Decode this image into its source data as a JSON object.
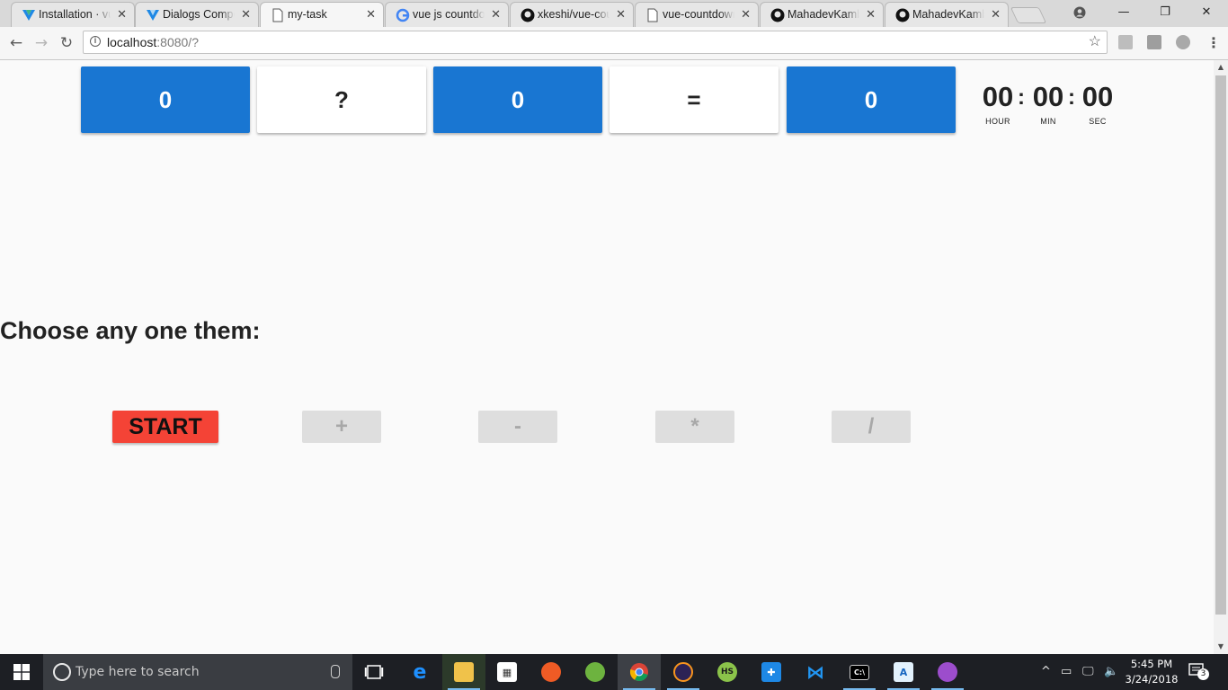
{
  "browser": {
    "tabs": [
      {
        "title": "Installation · vuetify",
        "icon": "vuetify-logo-icon"
      },
      {
        "title": "Dialogs Component",
        "icon": "vuetify-logo-icon"
      },
      {
        "title": "my-task",
        "icon": "page-icon",
        "active": true
      },
      {
        "title": "vue js countdown",
        "icon": "google-icon"
      },
      {
        "title": "xkeshi/vue-countdown",
        "icon": "github-icon"
      },
      {
        "title": "vue-countdown",
        "icon": "page-icon"
      },
      {
        "title": "MahadevKamble",
        "icon": "github-icon"
      },
      {
        "title": "MahadevKamble",
        "icon": "github-icon"
      }
    ],
    "address": {
      "host": "localhost",
      "rest": ":8080/?"
    }
  },
  "page": {
    "cards": [
      {
        "value": "0",
        "color": "#1976d2"
      },
      {
        "value": "?",
        "color": "#ffffff"
      },
      {
        "value": "0",
        "color": "#1976d2"
      },
      {
        "value": "=",
        "color": "#ffffff"
      },
      {
        "value": "0",
        "color": "#1976d2"
      }
    ],
    "timer": {
      "hours": "00",
      "hours_label": "HOUR",
      "minutes": "00",
      "minutes_label": "MIN",
      "seconds": "00",
      "seconds_label": "SEC",
      "separator": ":"
    },
    "heading": "Choose any one them:",
    "buttons": {
      "start": "START",
      "plus": "+",
      "minus": "-",
      "multiply": "*",
      "divide": "/"
    },
    "colors": {
      "start": "#f44336",
      "primary": "#1976d2",
      "disabled": "#dedede"
    }
  },
  "taskbar": {
    "search_placeholder": "Type here to search",
    "time": "5:45 PM",
    "date": "3/24/2018",
    "notification_count": "3"
  }
}
